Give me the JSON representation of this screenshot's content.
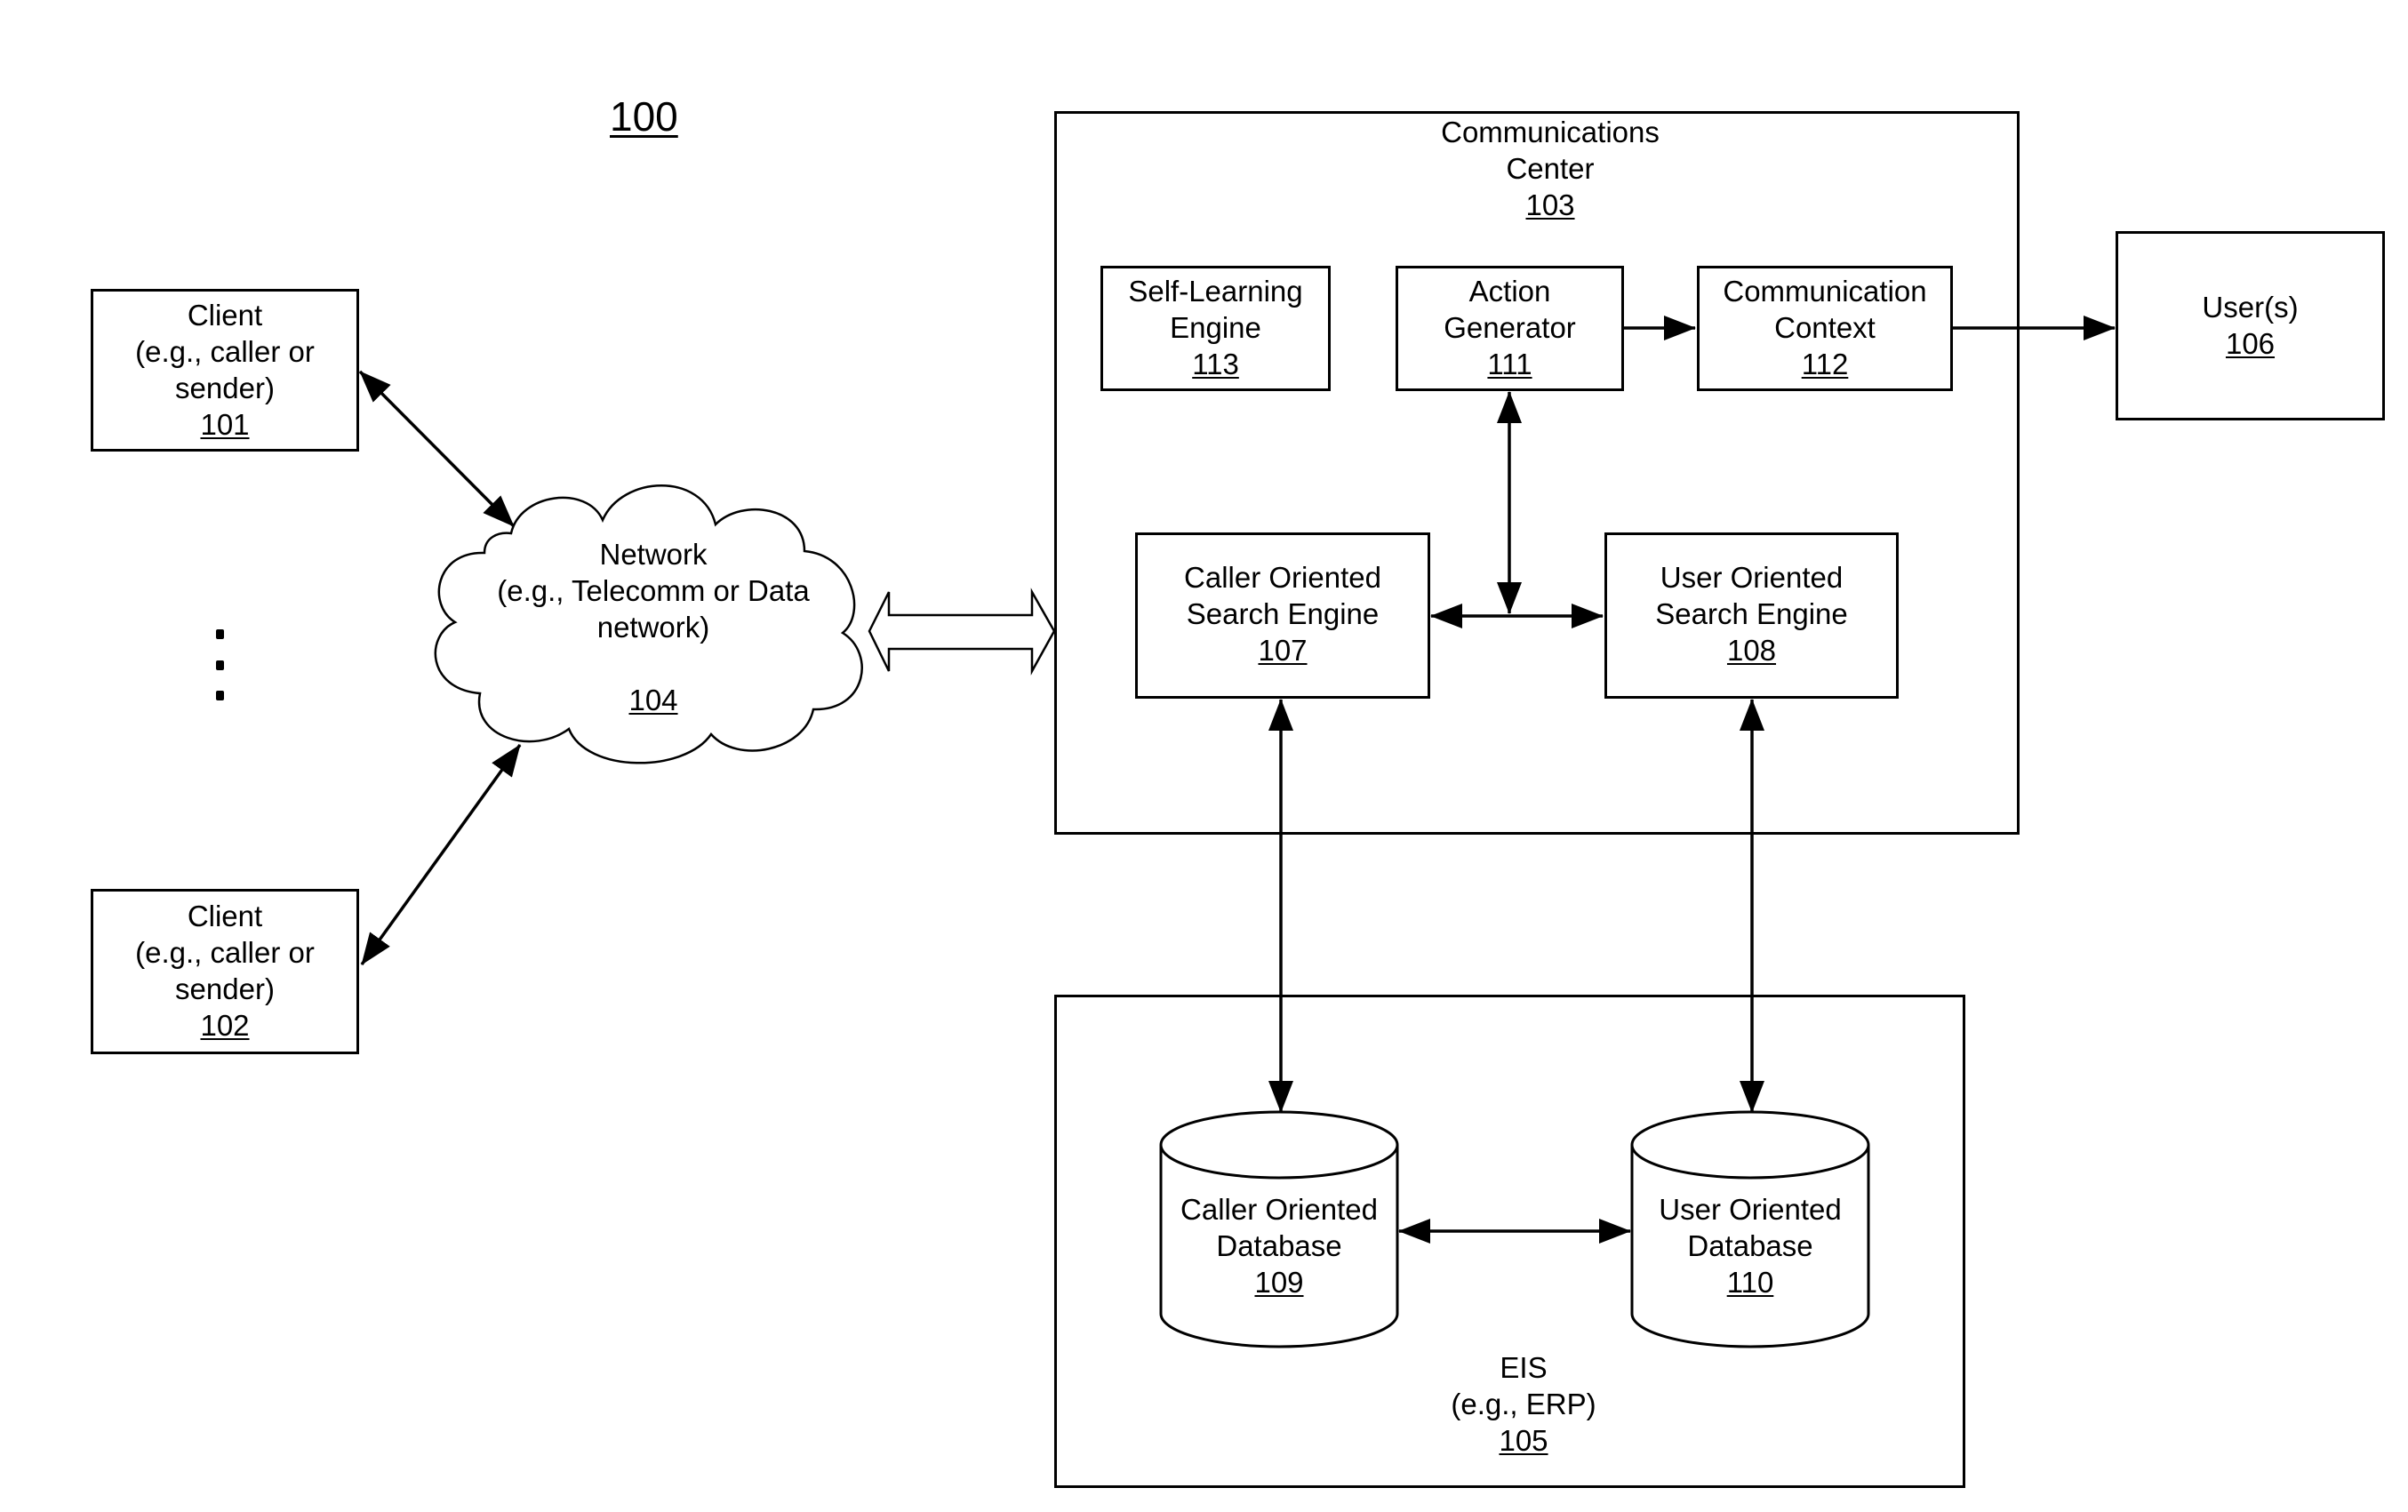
{
  "figure_number": "100",
  "nodes": {
    "client_1": {
      "lines": [
        "Client",
        "(e.g., caller or",
        "sender)"
      ],
      "ref": "101"
    },
    "client_2": {
      "lines": [
        "Client",
        "(e.g., caller or",
        "sender)"
      ],
      "ref": "102"
    },
    "network": {
      "lines": [
        "Network",
        "(e.g., Telecomm or Data",
        "network)"
      ],
      "ref": "104"
    },
    "communications_center": {
      "lines": [
        "Communications",
        "Center"
      ],
      "ref": "103"
    },
    "self_learning_engine": {
      "lines": [
        "Self-Learning",
        "Engine"
      ],
      "ref": "113"
    },
    "action_generator": {
      "lines": [
        "Action",
        "Generator"
      ],
      "ref": "111"
    },
    "communication_context": {
      "lines": [
        "Communication",
        "Context"
      ],
      "ref": "112"
    },
    "users": {
      "lines": [
        "User(s)"
      ],
      "ref": "106"
    },
    "caller_search_engine": {
      "lines": [
        "Caller Oriented",
        "Search Engine"
      ],
      "ref": "107"
    },
    "user_search_engine": {
      "lines": [
        "User Oriented",
        "Search Engine"
      ],
      "ref": "108"
    },
    "caller_database": {
      "lines": [
        "Caller Oriented",
        "Database"
      ],
      "ref": "109"
    },
    "user_database": {
      "lines": [
        "User Oriented",
        "Database"
      ],
      "ref": "110"
    },
    "eis": {
      "lines": [
        "EIS",
        "(e.g., ERP)"
      ],
      "ref": "105"
    }
  },
  "connections": [
    {
      "from": "client_1",
      "to": "network",
      "type": "bidirectional"
    },
    {
      "from": "client_2",
      "to": "network",
      "type": "bidirectional"
    },
    {
      "from": "network",
      "to": "communications_center",
      "type": "bidirectional-hollow"
    },
    {
      "from": "action_generator",
      "to": "communication_context",
      "type": "directed"
    },
    {
      "from": "communication_context",
      "to": "users",
      "type": "directed"
    },
    {
      "from": "action_generator",
      "to": "search_engines_link",
      "type": "bidirectional"
    },
    {
      "from": "caller_search_engine",
      "to": "user_search_engine",
      "type": "bidirectional"
    },
    {
      "from": "caller_search_engine",
      "to": "caller_database",
      "type": "bidirectional"
    },
    {
      "from": "user_search_engine",
      "to": "user_database",
      "type": "bidirectional"
    },
    {
      "from": "caller_database",
      "to": "user_database",
      "type": "bidirectional"
    }
  ],
  "ellipsis": "more clients"
}
